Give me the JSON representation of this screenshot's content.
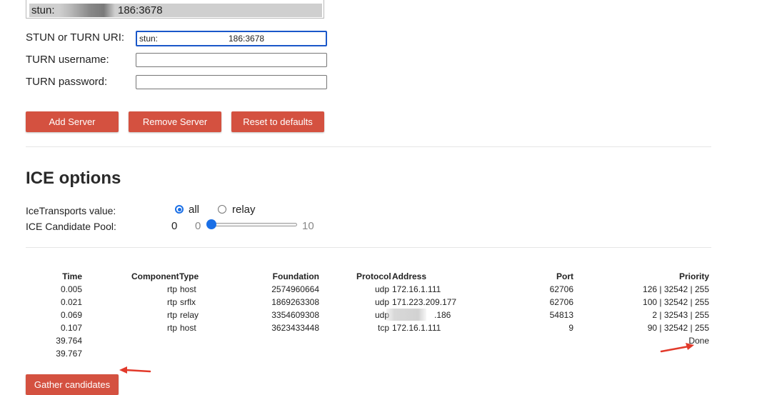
{
  "servers": {
    "list_item": {
      "prefix": "stun:",
      "suffix": "186:3678"
    }
  },
  "form": {
    "uri_label": "STUN or TURN URI:",
    "uri_value": "stun:",
    "uri_value_tail": "186:3678",
    "username_label": "TURN username:",
    "username_value": "",
    "password_label": "TURN password:",
    "password_value": ""
  },
  "buttons": {
    "add": "Add Server",
    "remove": "Remove Server",
    "reset": "Reset to defaults",
    "gather": "Gather candidates"
  },
  "ice": {
    "heading": "ICE options",
    "transports_label": "IceTransports value:",
    "transports_options": [
      "all",
      "relay"
    ],
    "transports_selected": "all",
    "pool_label": "ICE Candidate Pool:",
    "pool_value": "0",
    "slider_min": "0",
    "slider_max": "10"
  },
  "table": {
    "headers": [
      "Time",
      "Component",
      "Type",
      "Foundation",
      "Protocol",
      "Address",
      "Port",
      "Priority"
    ],
    "rows": [
      {
        "time": "0.005",
        "component": "rtp",
        "type": "host",
        "foundation": "2574960664",
        "protocol": "udp",
        "address": "172.16.1.111",
        "port": "62706",
        "priority": "126 | 32542 | 255"
      },
      {
        "time": "0.021",
        "component": "rtp",
        "type": "srflx",
        "foundation": "1869263308",
        "protocol": "udp",
        "address": "171.223.209.177",
        "port": "62706",
        "priority": "100 | 32542 | 255"
      },
      {
        "time": "0.069",
        "component": "rtp",
        "type": "relay",
        "foundation": "3354609308",
        "protocol": "udp",
        "address": ".186",
        "port": "54813",
        "priority": "2 | 32543 | 255"
      },
      {
        "time": "0.107",
        "component": "rtp",
        "type": "host",
        "foundation": "3623433448",
        "protocol": "tcp",
        "address": "172.16.1.111",
        "port": "9",
        "priority": "90 | 32542 | 255"
      }
    ],
    "extra_times": [
      "39.764",
      "39.767"
    ],
    "done_text": "Done"
  },
  "colors": {
    "button": "#d45140",
    "accent": "#1a6fe6",
    "arrow": "#e23a2b"
  }
}
